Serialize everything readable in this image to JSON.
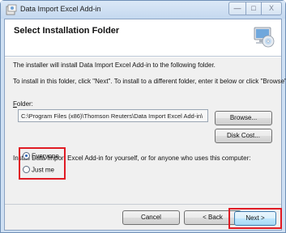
{
  "window": {
    "title": "Data Import Excel Add-in",
    "controls": {
      "minimize": "—",
      "maximize": "□",
      "close": "X"
    }
  },
  "header": {
    "title": "Select Installation Folder"
  },
  "body": {
    "intro": "The installer will install Data Import Excel Add-in to the following folder.",
    "instructions": "To install in this folder, click \"Next\". To install to a different folder, enter it below or click \"Browse\".",
    "folder_label_accel": "F",
    "folder_label_rest": "older:",
    "folder_value": "C:\\Program Files (x86)\\Thomson Reuters\\Data Import Excel Add-in\\",
    "browse_label": "Browse...",
    "disk_cost_label": "Disk Cost...",
    "install_for_text": "Install Data Import Excel Add-in for yourself, or for anyone who uses this computer:",
    "radio_options": [
      {
        "label": "Everyone",
        "selected": true
      },
      {
        "label": "Just me",
        "selected": false
      }
    ]
  },
  "footer": {
    "cancel_label": "Cancel",
    "back_label": "< Back",
    "next_label": "Next >"
  },
  "colors": {
    "highlight": "#e01b24",
    "titlebar": "#c4d8ef",
    "next_button": "#bee6fd"
  }
}
